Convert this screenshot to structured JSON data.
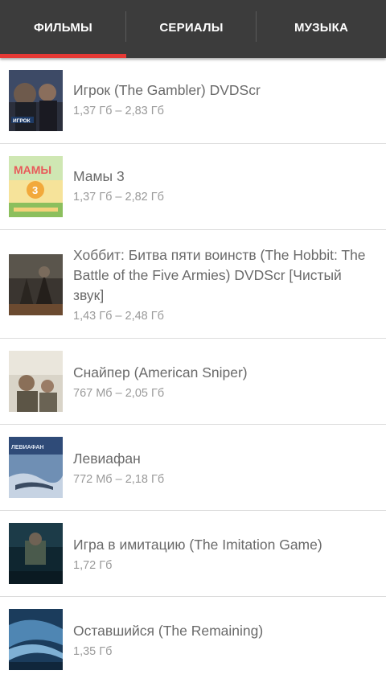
{
  "tabs": [
    {
      "label": "ФИЛЬМЫ"
    },
    {
      "label": "СЕРИАЛЫ"
    },
    {
      "label": "МУЗЫКА"
    }
  ],
  "movies": [
    {
      "title": "Игрок (The Gambler) DVDScr",
      "size": "1,37 Гб – 2,83 Гб",
      "poster_text": "ИГРОК"
    },
    {
      "title": "Мамы 3",
      "size": "1,37 Гб – 2,82 Гб",
      "poster_text": "МАМЫ 3"
    },
    {
      "title": "Хоббит: Битва пяти воинств (The Hobbit: The Battle of the Five Armies) DVDScr [Чистый звук]",
      "size": "1,43 Гб – 2,48 Гб",
      "poster_text": ""
    },
    {
      "title": "Снайпер  (American Sniper)",
      "size": "767 Мб – 2,05 Гб",
      "poster_text": ""
    },
    {
      "title": "Левиафан",
      "size": "772 Мб – 2,18 Гб",
      "poster_text": "ЛЕВИАФАН"
    },
    {
      "title": "Игра в имитацию  (The Imitation Game)",
      "size": "1,72 Гб",
      "poster_text": ""
    },
    {
      "title": "Оставшийся (The Remaining)",
      "size": "1,35 Гб",
      "poster_text": ""
    }
  ]
}
